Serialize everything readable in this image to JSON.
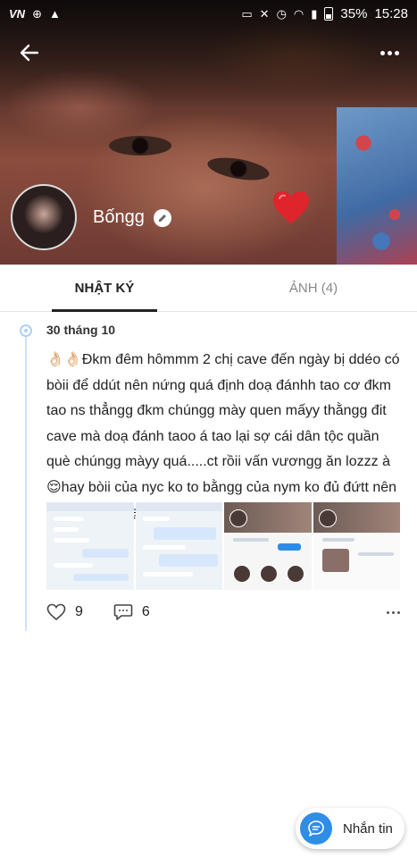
{
  "status_bar": {
    "carrier": "VN",
    "battery_percent": "35%",
    "time": "15:28"
  },
  "profile": {
    "name": "Bốngg"
  },
  "tabs": [
    {
      "label": "NHẬT KÝ",
      "active": true
    },
    {
      "label": "ẢNH (4)",
      "active": false
    }
  ],
  "post": {
    "date": "30 tháng 10",
    "text": "👌🏻👌🏻Đkm đêm hômmm 2 chị cave đến ngày bị ddéo có bòii để ddút nên nứng quá định doạ đánhh tao cơ đkm tao ns thẳngg đkm chúngg mày quen mấyy thằngg đit cave mà doạ đánh taoo á tao lại sợ cái dân tộc quần què chúngg màyy quá.....ct rồii vấn vươngg ăn lozzz à😌hay bòii của nyc ko to bằngg của nym ko đủ đứtt nên nịnhh quayy lại😌😌😌",
    "likes": "9",
    "comments": "6",
    "images_count": 4
  },
  "message_button": {
    "label": "Nhắn tin"
  },
  "colors": {
    "accent": "#2f8de8",
    "timeline": "#aed0f5",
    "heart": "#e0242c"
  },
  "icons": [
    "back-arrow-icon",
    "more-vertical-dots-icon",
    "edit-pencil-icon",
    "heart-icon",
    "like-heart-icon",
    "comment-icon",
    "chat-bubble-icon"
  ]
}
